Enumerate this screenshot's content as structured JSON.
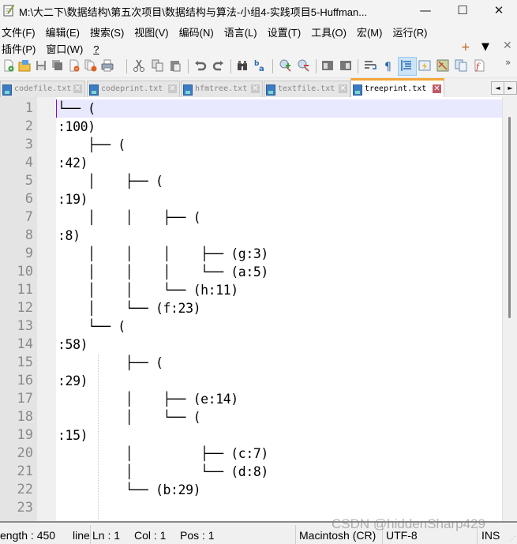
{
  "window": {
    "title": "M:\\大二下\\数据结构\\第五次项目\\数据结构与算法-小组4-实践项目5-Huffman...",
    "app_icon": "notepad-plus-plus-icon",
    "controls": {
      "minimize": "—",
      "maximize": "☐",
      "close": "✕"
    }
  },
  "menu": {
    "row1": [
      "文件(F)",
      "编辑(E)",
      "搜索(S)",
      "视图(V)",
      "编码(N)",
      "语言(L)",
      "设置(T)",
      "工具(O)",
      "宏(M)",
      "运行(R)"
    ],
    "row2": [
      "插件(P)",
      "窗口(W)",
      "?"
    ],
    "doc_controls": {
      "add": "+",
      "list": "▼",
      "close": "✕"
    }
  },
  "toolbar": {
    "buttons": [
      "new-file",
      "open-file",
      "save",
      "save-all",
      "close",
      "close-all",
      "print",
      "cut",
      "copy",
      "paste",
      "undo",
      "redo",
      "find",
      "replace",
      "zoom-in",
      "zoom-out",
      "sync-vertical",
      "sync-horizontal",
      "word-wrap",
      "show-all-chars",
      "indent-guide",
      "user-defined-language",
      "document-map",
      "document-list",
      "function-list"
    ],
    "overflow": "»"
  },
  "tabs": [
    {
      "label": "codefile.txt",
      "active": false
    },
    {
      "label": "codeprint.txt",
      "active": false
    },
    {
      "label": "hfmtree.txt",
      "active": false
    },
    {
      "label": "textfile.txt",
      "active": false
    },
    {
      "label": "treeprint.txt",
      "active": true
    }
  ],
  "tab_nav": {
    "left": "◄",
    "right": "►"
  },
  "editor": {
    "current_line": 1,
    "lines": [
      "└── (",
      ":100)",
      "    ├── (",
      ":42)",
      "    │    ├── (",
      ":19)",
      "    │    │    ├── (",
      ":8)",
      "    │    │    │    ├── (g:3)",
      "    │    │    │    └── (a:5)",
      "    │    │    └── (h:11)",
      "    │    └── (f:23)",
      "    └── (",
      ":58)",
      "         ├── (",
      ":29)",
      "         │    ├── (e:14)",
      "         │    └── (",
      ":15)",
      "         │         ├── (c:7)",
      "         │         └── (d:8)",
      "         └── (b:29)",
      ""
    ]
  },
  "status": {
    "length": "ength : 450",
    "lines": "line",
    "ln": "Ln : 1",
    "col": "Col : 1",
    "pos": "Pos : 1",
    "eol": "Macintosh (CR)",
    "encoding": "UTF-8",
    "mode": "INS"
  },
  "watermark": "CSDN @hiddenSharp429"
}
